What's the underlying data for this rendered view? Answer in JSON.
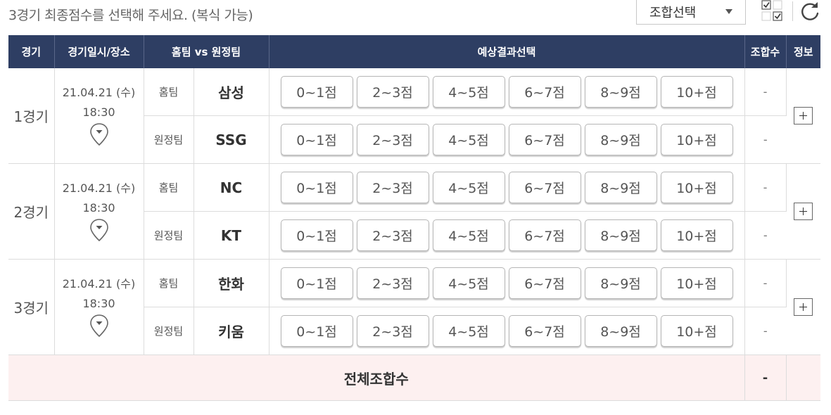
{
  "instruction": "3경기 최종점수를 선택해 주세요. (복식 가능)",
  "combo_select": {
    "label": "조합선택"
  },
  "headers": {
    "game": "경기",
    "datetime": "경기일시/장소",
    "teams": "홈팀 vs 원정팀",
    "prediction": "예상결과선택",
    "combo": "조합수",
    "info": "정보"
  },
  "score_options": [
    "0~1점",
    "2~3점",
    "4~5점",
    "6~7점",
    "8~9점",
    "10+점"
  ],
  "games": [
    {
      "label": "1경기",
      "date": "21.04.21 (수)",
      "time": "18:30",
      "home": {
        "side": "홈팀",
        "team": "삼성",
        "combo": "-"
      },
      "away": {
        "side": "원정팀",
        "team": "SSG",
        "combo": "-"
      }
    },
    {
      "label": "2경기",
      "date": "21.04.21 (수)",
      "time": "18:30",
      "home": {
        "side": "홈팀",
        "team": "NC",
        "combo": "-"
      },
      "away": {
        "side": "원정팀",
        "team": "KT",
        "combo": "-"
      }
    },
    {
      "label": "3경기",
      "date": "21.04.21 (수)",
      "time": "18:30",
      "home": {
        "side": "홈팀",
        "team": "한화",
        "combo": "-"
      },
      "away": {
        "side": "원정팀",
        "team": "키움",
        "combo": "-"
      }
    }
  ],
  "total": {
    "label": "전체조합수",
    "value": "-"
  },
  "icons": {
    "location": "map-pin-icon",
    "expand": "plus-icon",
    "refresh": "refresh-icon",
    "check_toggle": "checkbox-toggle-icon",
    "dropdown": "caret-down-icon"
  },
  "colors": {
    "header_bg": "#2e3e63",
    "total_row_bg": "#fdf0f0"
  }
}
